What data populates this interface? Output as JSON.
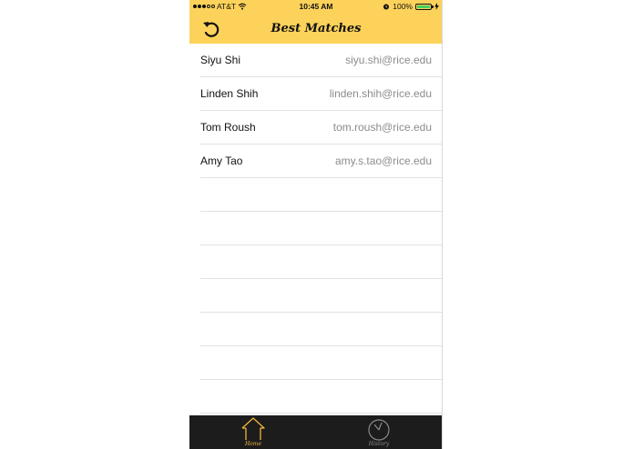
{
  "status_bar": {
    "carrier": "AT&T",
    "time": "10:45 AM",
    "battery_percent": "100%",
    "battery_color": "#43d15b"
  },
  "nav": {
    "title": "Best Matches",
    "back_icon": "undo-arrow-icon"
  },
  "matches": [
    {
      "name": "Siyu Shi",
      "email": "siyu.shi@rice.edu"
    },
    {
      "name": "Linden Shih",
      "email": "linden.shih@rice.edu"
    },
    {
      "name": "Tom Roush",
      "email": "tom.roush@rice.edu"
    },
    {
      "name": "Amy Tao",
      "email": "amy.s.tao@rice.edu"
    }
  ],
  "tabs": [
    {
      "label": "Home",
      "icon": "home-icon",
      "active": true,
      "color": "#f2b43a"
    },
    {
      "label": "History",
      "icon": "history-icon",
      "active": false,
      "color": "#8a8a8a"
    }
  ],
  "colors": {
    "accent": "#fcd25a",
    "tabbar": "#1c1c1c"
  }
}
